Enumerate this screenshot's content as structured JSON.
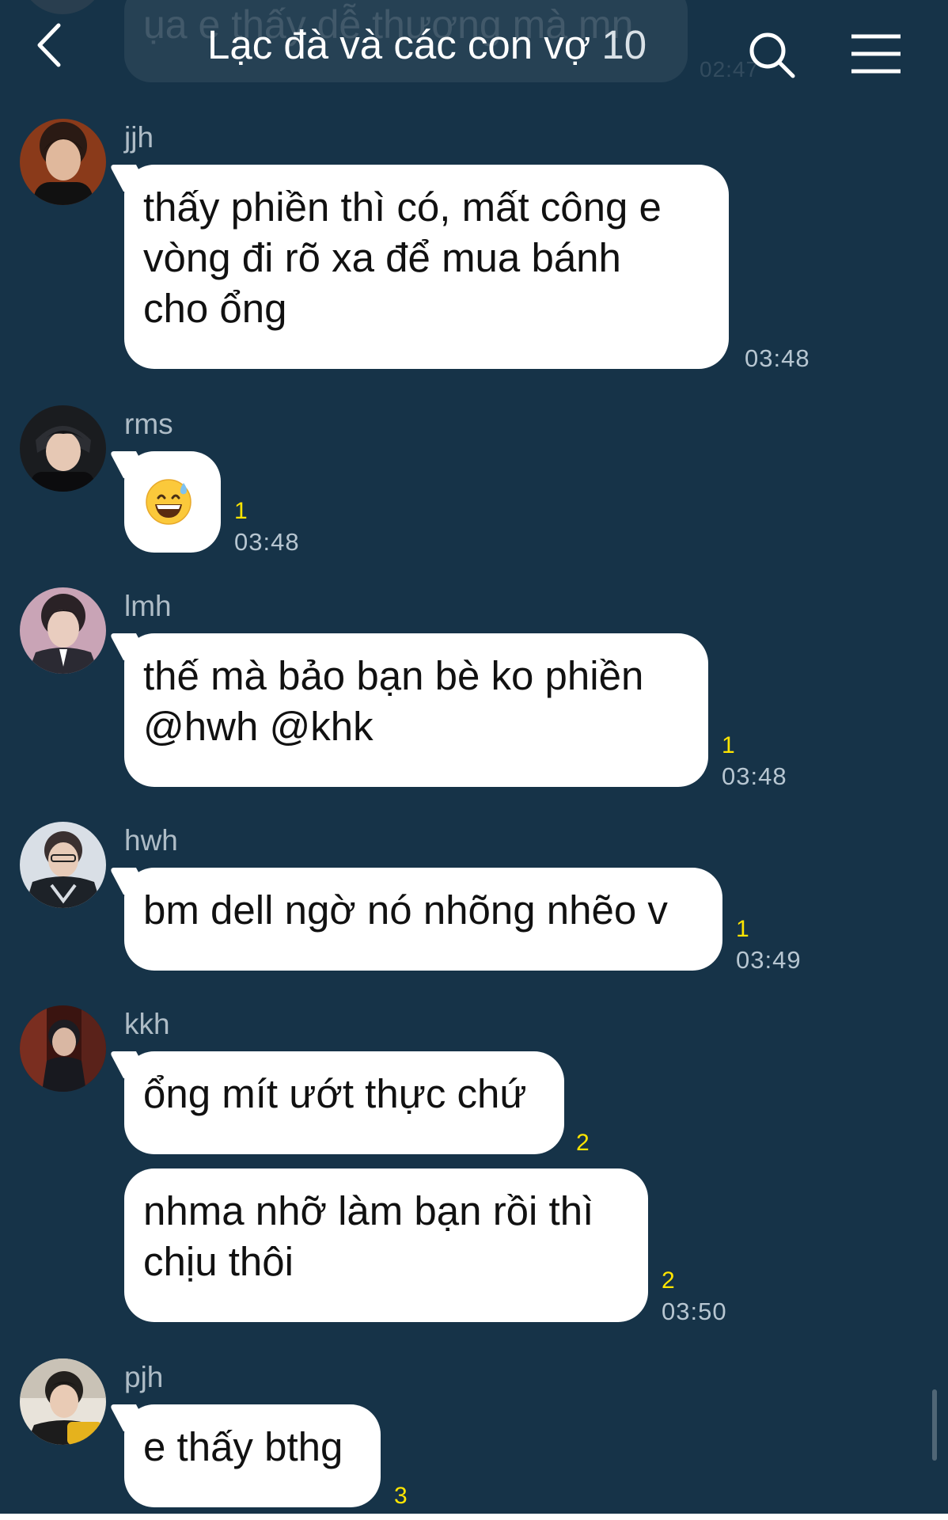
{
  "header": {
    "title": "Lạc đà và các con vợ",
    "member_count": "10",
    "ghost_message": "ụa e thấy dễ thương mà mn",
    "ghost_time": "02:47"
  },
  "colors": {
    "background": "#163348",
    "bubble": "#ffffff",
    "unread": "#ffe500",
    "meta": "#b7c6d1"
  },
  "messages": [
    {
      "sender": "jjh",
      "lines": [
        "thấy phiền thì có, mất công e",
        "vòng đi rõ xa để mua bánh",
        "cho ổng"
      ],
      "time": "03:48",
      "unread": ""
    },
    {
      "sender": "rms",
      "emoji": "grinning-face-with-sweat",
      "time": "03:48",
      "unread": "1"
    },
    {
      "sender": "lmh",
      "lines": [
        "thế mà bảo bạn bè ko phiền",
        "@hwh @khk"
      ],
      "time": "03:48",
      "unread": "1"
    },
    {
      "sender": "hwh",
      "lines": [
        "bm dell ngờ nó nhõng nhẽo v"
      ],
      "time": "03:49",
      "unread": "1"
    },
    {
      "sender": "kkh",
      "lines": [
        "ổng mít ướt thực chứ"
      ],
      "time": "",
      "unread": "2"
    },
    {
      "sender": "",
      "lines": [
        "nhma nhỡ làm bạn rồi thì",
        "chịu thôi"
      ],
      "time": "03:50",
      "unread": "2"
    },
    {
      "sender": "pjh",
      "lines": [
        "e thấy bthg"
      ],
      "time": "",
      "unread": "3"
    }
  ]
}
